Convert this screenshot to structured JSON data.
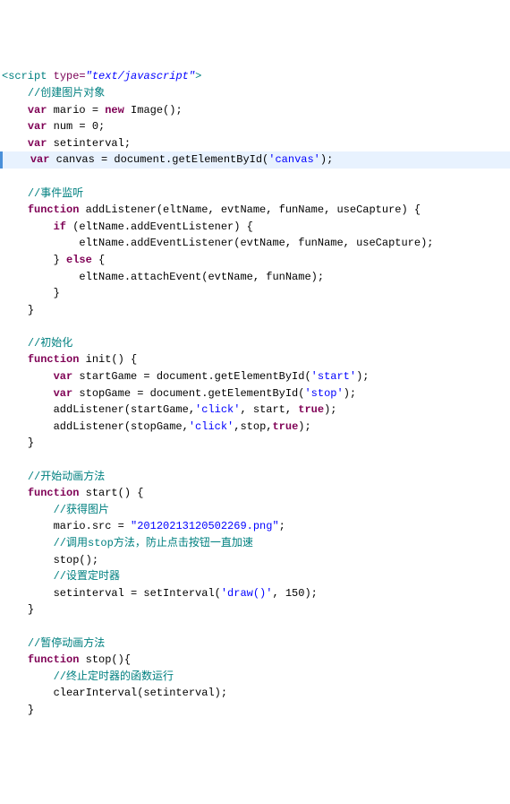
{
  "tag_open_script": "<script",
  "attr_type_name": "type=",
  "attr_type_val": "\"text/javascript\"",
  "tag_open_close": ">",
  "c_create_img": "//创建图片对象",
  "kw_var": "var",
  "kw_new": "new",
  "kw_function": "function",
  "kw_if": "if",
  "kw_else": "else",
  "kw_true": "true",
  "l_mario": " mario = ",
  "l_imageobj": " Image();",
  "l_num": " num = 0;",
  "l_setinterval_decl": " setinterval;",
  "l_canvas_a": " canvas = document.getElementById(",
  "str_canvas": "'canvas'",
  "l_canvas_b": ");",
  "c_event_listen": "//事件监听",
  "l_addlistener_sig": " addListener(eltName, evtName, funName, useCapture) {",
  "l_if_cond": " (eltName.addEventListener) {",
  "l_add_evt": "eltName.addEventListener(evtName, funName, useCapture);",
  "l_else": " {",
  "l_attach_evt": "eltName.attachEvent(evtName, funName);",
  "brace_close": "}",
  "c_init": "//初始化",
  "l_init_sig": " init() {",
  "l_startgame_a": " startGame = document.getElementById(",
  "str_start": "'start'",
  "l_startgame_b": ");",
  "l_stopgame_a": " stopGame = document.getElementById(",
  "str_stop": "'stop'",
  "l_stopgame_b": ");",
  "l_add_start_a": "addListener(startGame,",
  "str_click1": "'click'",
  "l_add_start_b": ", start, ",
  "l_add_start_c": ");",
  "l_add_stop_a": "addListener(stopGame,",
  "str_click2": "'click'",
  "l_add_stop_b": ",stop,",
  "l_add_stop_c": ");",
  "c_start_anim": "//开始动画方法",
  "l_start_sig": " start() {",
  "c_get_img": "//获得图片",
  "l_mario_src_a": "mario.src = ",
  "str_png": "\"20120213120502269.png\"",
  "l_mario_src_b": ";",
  "c_call_stop": "//调用stop方法，防止点击按钮一直加速",
  "l_stop_call": "stop();",
  "c_set_timer": "//设置定时器",
  "l_setint_a": "setinterval = setInterval(",
  "str_draw": "'draw()'",
  "l_setint_b": ", 150);",
  "c_pause_anim": "//暂停动画方法",
  "l_stop_sig": " stop(){",
  "c_terminate": "//终止定时器的函数运行",
  "l_clear": "clearInterval(setinterval);",
  "indent1": "    ",
  "indent2": "        ",
  "indent3": "            "
}
